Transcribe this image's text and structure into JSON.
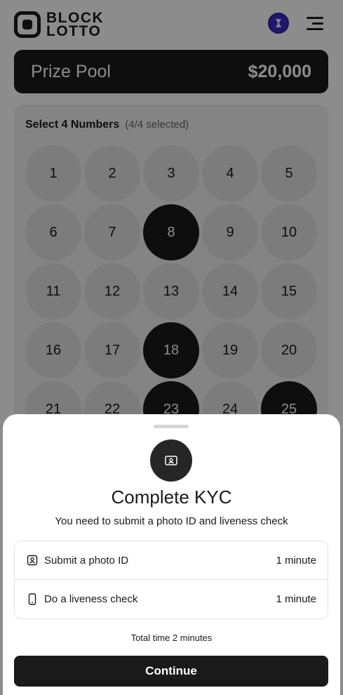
{
  "header": {
    "logo_line1": "BLOCK",
    "logo_line2": "LOTTO",
    "logo_icon": "block-lotto-logo-icon",
    "avatar_icon": "wallet-avatar-icon",
    "menu_icon": "hamburger-menu-icon"
  },
  "prize_pool": {
    "label": "Prize Pool",
    "value": "$20,000"
  },
  "number_picker": {
    "title": "Select 4 Numbers",
    "count": "(4/4 selected)",
    "numbers": [
      {
        "n": "1",
        "selected": false
      },
      {
        "n": "2",
        "selected": false
      },
      {
        "n": "3",
        "selected": false
      },
      {
        "n": "4",
        "selected": false
      },
      {
        "n": "5",
        "selected": false
      },
      {
        "n": "6",
        "selected": false
      },
      {
        "n": "7",
        "selected": false
      },
      {
        "n": "8",
        "selected": true
      },
      {
        "n": "9",
        "selected": false
      },
      {
        "n": "10",
        "selected": false
      },
      {
        "n": "11",
        "selected": false
      },
      {
        "n": "12",
        "selected": false
      },
      {
        "n": "13",
        "selected": false
      },
      {
        "n": "14",
        "selected": false
      },
      {
        "n": "15",
        "selected": false
      },
      {
        "n": "16",
        "selected": false
      },
      {
        "n": "17",
        "selected": false
      },
      {
        "n": "18",
        "selected": true
      },
      {
        "n": "19",
        "selected": false
      },
      {
        "n": "20",
        "selected": false
      },
      {
        "n": "21",
        "selected": false
      },
      {
        "n": "22",
        "selected": false
      },
      {
        "n": "23",
        "selected": true
      },
      {
        "n": "24",
        "selected": false
      },
      {
        "n": "25",
        "selected": true
      }
    ]
  },
  "kyc_sheet": {
    "icon": "id-card-icon",
    "title": "Complete KYC",
    "subtitle": "You need to submit a photo ID and liveness check",
    "steps": [
      {
        "icon": "photo-id-icon",
        "label": "Submit a photo ID",
        "time": "1 minute"
      },
      {
        "icon": "phone-icon",
        "label": "Do a liveness check",
        "time": "1 minute"
      }
    ],
    "total": "Total time 2 minutes",
    "continue_label": "Continue"
  },
  "colors": {
    "dark": "#1a1a1a",
    "selected_ball": "#1a1a1a",
    "unselected_ball": "#e2e2e2",
    "avatar": "#3a2fc9"
  }
}
